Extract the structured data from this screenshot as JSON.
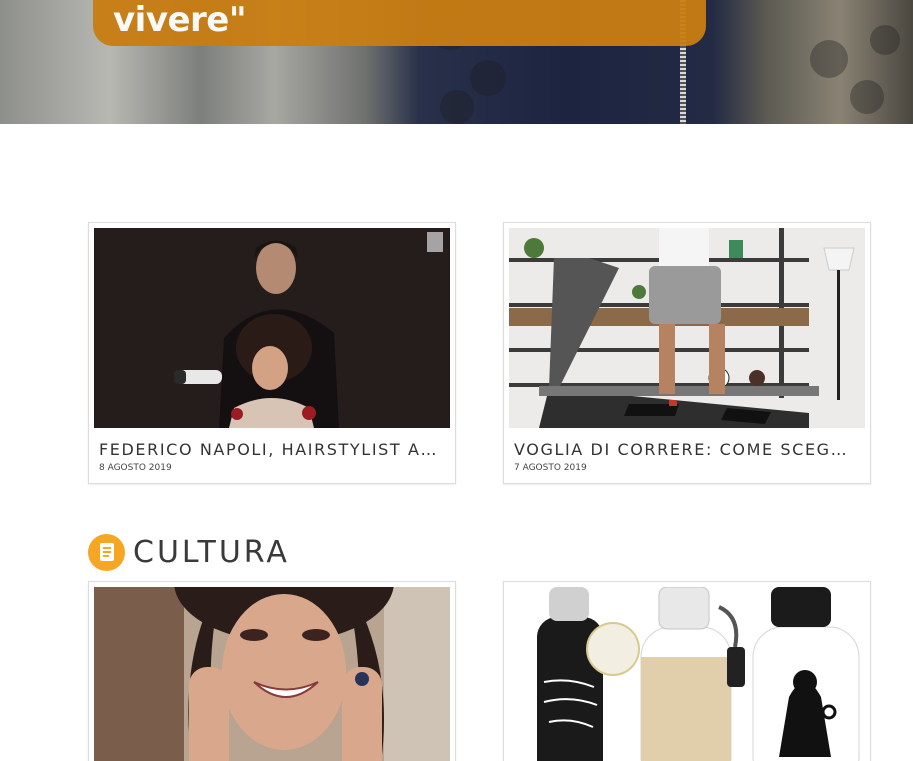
{
  "hero": {
    "caption_text": "vivere\""
  },
  "articles": [
    {
      "title": "FEDERICO NAPOLI, HAIRSTYLIST AL P...",
      "date": "8 AGOSTO 2019"
    },
    {
      "title": "VOGLIA DI CORRERE: COME SCEGLIER...",
      "date": "7 AGOSTO 2019"
    }
  ],
  "cultura": {
    "heading": "CULTURA",
    "icon": "book-icon"
  },
  "colors": {
    "accent": "#f5a623",
    "hero_caption": "#c97d12"
  }
}
